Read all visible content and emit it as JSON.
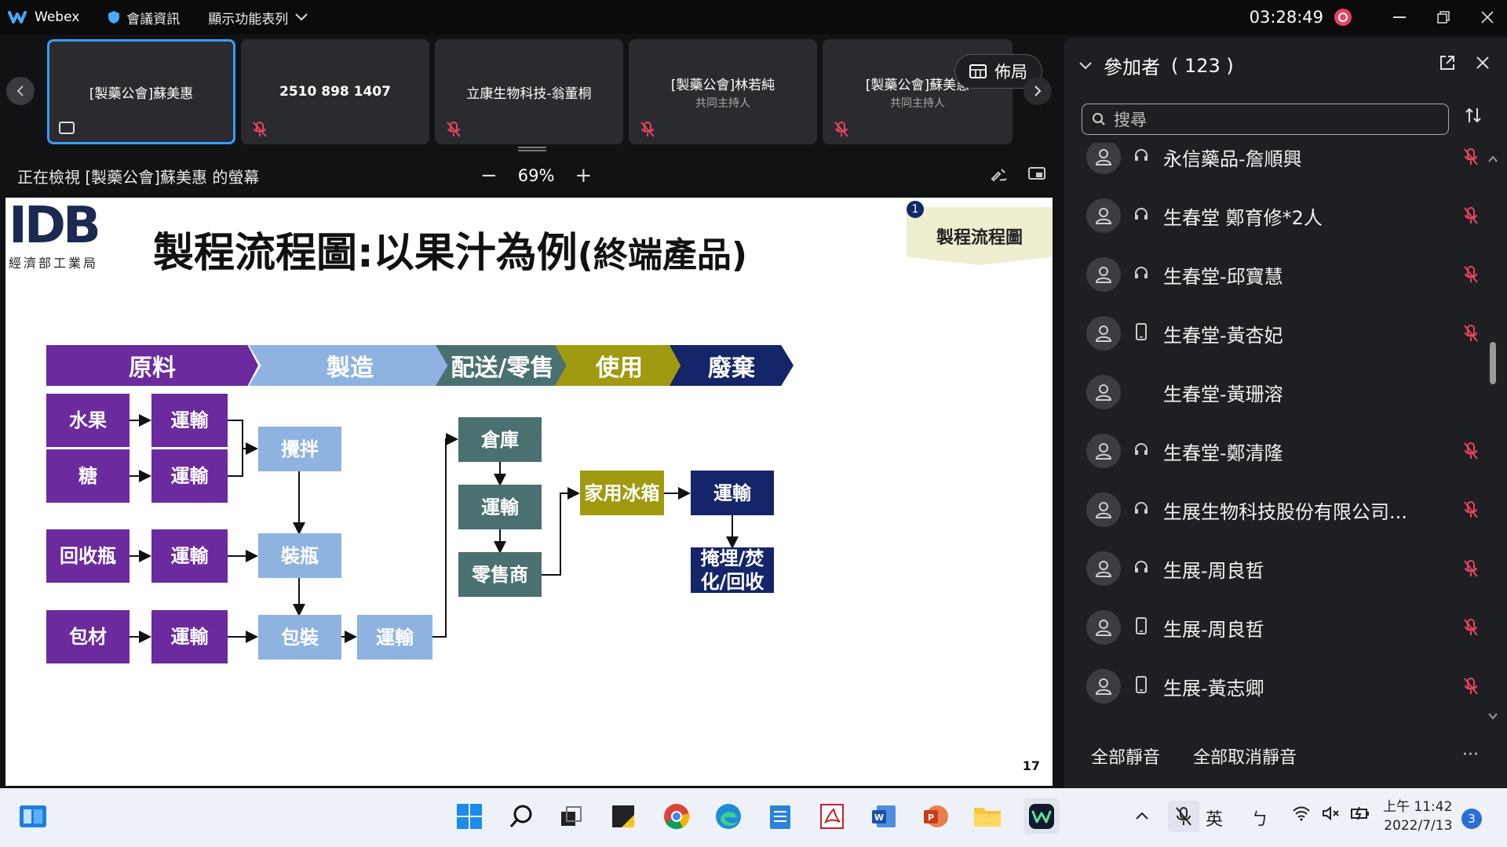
{
  "titlebar": {
    "app_name": "Webex",
    "meeting_info": "會議資訊",
    "show_menu": "顯示功能表列",
    "clock": "03:28:49"
  },
  "thumbnails": [
    {
      "name": "[製藥公會]蘇美惠",
      "sub": "",
      "active": true
    },
    {
      "name": "2510 898 1407",
      "sub": ""
    },
    {
      "name": "立康生物科技-翁董桐",
      "sub": ""
    },
    {
      "name": "[製藥公會]林若純",
      "sub": "共同主持人"
    },
    {
      "name": "[製藥公會]蘇美惠",
      "sub": "共同主持人"
    }
  ],
  "layout_label": "佈局",
  "viewing": {
    "text": "正在檢視 [製藥公會]蘇美惠 的螢幕",
    "zoom": "69%",
    "minus": "−",
    "plus": "+"
  },
  "slide": {
    "logo_letters": "IDB",
    "logo_caption": "經濟部工業局",
    "title_main": "製程流程圖:以果汁為例",
    "title_paren": "(終端產品)",
    "tag": "製程流程圖",
    "tag_number": "1",
    "page_number": "17",
    "phases": [
      "原料",
      "製造",
      "配送/零售",
      "使用",
      "廢棄"
    ],
    "boxes": {
      "fruit": "水果",
      "sugar": "糖",
      "bottle": "回收瓶",
      "pack_mat": "包材",
      "transport": "運輸",
      "mix": "攪拌",
      "fill": "裝瓶",
      "package": "包裝",
      "warehouse": "倉庫",
      "retailer": "零售商",
      "fridge": "家用冰箱",
      "disposal_1": "掩埋/焚",
      "disposal_2": "化/回收"
    },
    "colors": {
      "purple": "#6b2a9e",
      "light_blue": "#8fb3e0",
      "teal": "#4a7070",
      "olive": "#a09a10",
      "navy": "#14256a"
    }
  },
  "panel": {
    "title": "參加者",
    "count": "( 123 )",
    "search_placeholder": "搜尋",
    "participants": [
      {
        "name": "永信藥品-詹順興",
        "device": "headset",
        "muted": true
      },
      {
        "name": "生春堂 鄭育修*2人",
        "device": "headset",
        "muted": true
      },
      {
        "name": "生春堂-邱寶慧",
        "device": "headset",
        "muted": true
      },
      {
        "name": "生春堂-黃杏妃",
        "device": "phone",
        "muted": true
      },
      {
        "name": "生春堂-黃珊溶",
        "device": "",
        "muted": false
      },
      {
        "name": "生春堂-鄭清隆",
        "device": "headset",
        "muted": true
      },
      {
        "name": "生展生物科技股份有限公司...",
        "device": "headset",
        "muted": true
      },
      {
        "name": "生展-周良哲",
        "device": "headset",
        "muted": true
      },
      {
        "name": "生展-周良哲",
        "device": "phone",
        "muted": true
      },
      {
        "name": "生展-黃志卿",
        "device": "phone",
        "muted": true
      }
    ],
    "mute_all": "全部靜音",
    "unmute_all": "全部取消靜音",
    "more": "···"
  },
  "taskbar": {
    "ime_lang": "英",
    "ime_mode": "ㄅ",
    "time": "上午 11:42",
    "date": "2022/7/13",
    "notifications": "3"
  }
}
